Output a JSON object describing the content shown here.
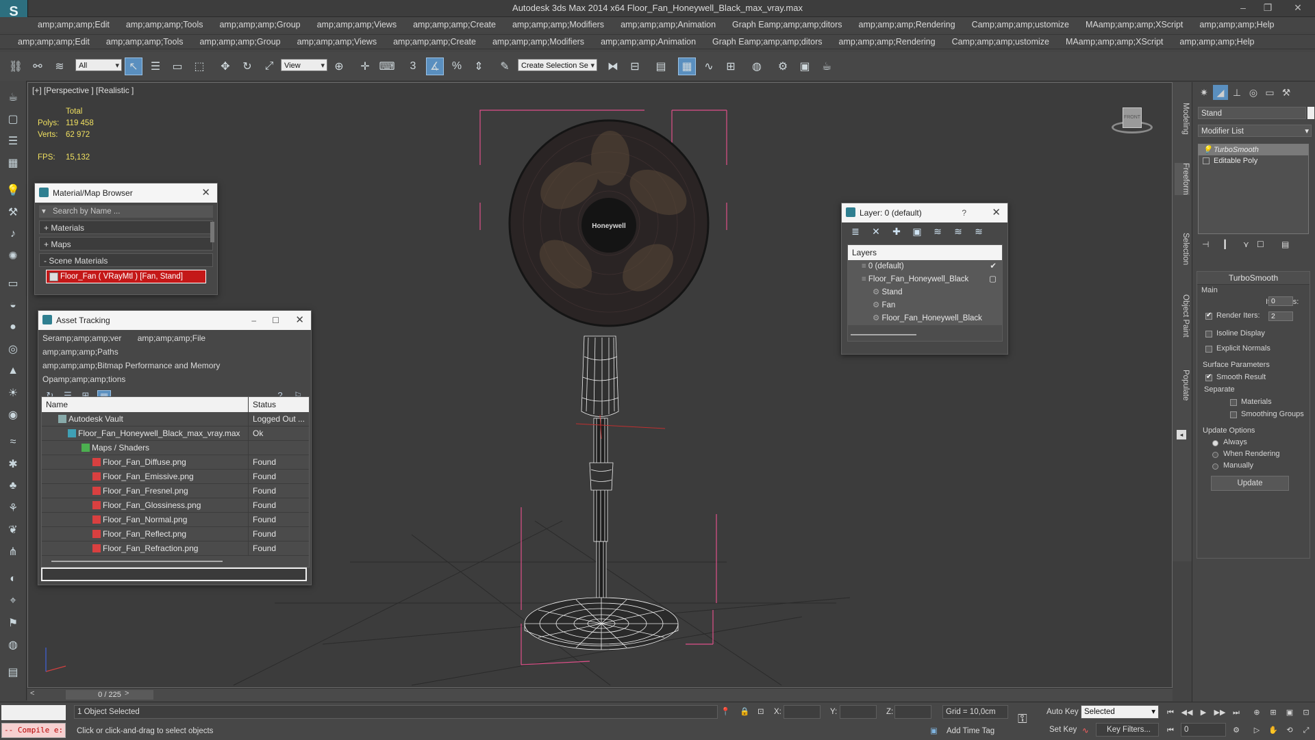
{
  "window": {
    "title": "Autodesk 3ds Max  2014 x64     Floor_Fan_Honeywell_Black_max_vray.max",
    "controls": [
      "–",
      "❐",
      "✕"
    ]
  },
  "menubar_top": [
    "amp;amp;amp;Edit",
    "amp;amp;amp;Tools",
    "amp;amp;amp;Group",
    "amp;amp;amp;Views",
    "amp;amp;amp;Create",
    "amp;amp;amp;Modifiers",
    "amp;amp;amp;Animation",
    "Graph Eamp;amp;amp;ditors",
    "amp;amp;amp;Rendering",
    "Camp;amp;amp;ustomize",
    "MAamp;amp;amp;XScript",
    "amp;amp;amp;Help"
  ],
  "menubar_bottom": [
    "amp;amp;amp;Edit",
    "amp;amp;amp;Tools",
    "amp;amp;amp;Group",
    "amp;amp;amp;Views",
    "amp;amp;amp;Create",
    "amp;amp;amp;Modifiers",
    "amp;amp;amp;Animation",
    "Graph Eamp;amp;amp;ditors",
    "amp;amp;amp;Rendering",
    "Camp;amp;amp;ustomize",
    "MAamp;amp;amp;XScript",
    "amp;amp;amp;Help"
  ],
  "toolbar": {
    "selection_filter": "All",
    "reference_coord": "View",
    "named_selection": "Create Selection Se"
  },
  "viewport": {
    "label": "[+] [Perspective ] [Realistic ]",
    "stats": {
      "total_label": "Total",
      "polys_label": "Polys:",
      "polys_value": "119 458",
      "verts_label": "Verts:",
      "verts_value": "62 972",
      "fps_label": "FPS:",
      "fps_value": "15,132"
    },
    "fan_brand": "Honeywell",
    "viewcube_label": "FRONT"
  },
  "material_browser": {
    "title": "Material/Map Browser",
    "search_placeholder": "Search by Name ...",
    "sections": [
      "+ Materials",
      "+ Maps",
      "- Scene Materials"
    ],
    "scene_item": "Floor_Fan  ( VRayMtl ) [Fan, Stand]"
  },
  "asset_tracking": {
    "title": "Asset Tracking",
    "menu_line1": [
      "Seramp;amp;amp;ver",
      "amp;amp;amp;File",
      "amp;amp;amp;Paths"
    ],
    "menu_line2": "amp;amp;amp;Bitmap Performance and Memory",
    "menu_line3": "Opamp;amp;amp;tions",
    "columns": {
      "name": "Name",
      "status": "Status"
    },
    "rows": [
      {
        "name": "Autodesk Vault",
        "status": "Logged Out ...",
        "indent": 0,
        "icon": "vault"
      },
      {
        "name": "Floor_Fan_Honeywell_Black_max_vray.max",
        "status": "Ok",
        "indent": 1,
        "icon": "max"
      },
      {
        "name": "Maps / Shaders",
        "status": "",
        "indent": 2,
        "icon": "maps"
      },
      {
        "name": "Floor_Fan_Diffuse.png",
        "status": "Found",
        "indent": 3,
        "icon": "png"
      },
      {
        "name": "Floor_Fan_Emissive.png",
        "status": "Found",
        "indent": 3,
        "icon": "png"
      },
      {
        "name": "Floor_Fan_Fresnel.png",
        "status": "Found",
        "indent": 3,
        "icon": "png"
      },
      {
        "name": "Floor_Fan_Glossiness.png",
        "status": "Found",
        "indent": 3,
        "icon": "png"
      },
      {
        "name": "Floor_Fan_Normal.png",
        "status": "Found",
        "indent": 3,
        "icon": "png"
      },
      {
        "name": "Floor_Fan_Reflect.png",
        "status": "Found",
        "indent": 3,
        "icon": "png"
      },
      {
        "name": "Floor_Fan_Refraction.png",
        "status": "Found",
        "indent": 3,
        "icon": "png"
      }
    ]
  },
  "layer_panel": {
    "title": "Layer: 0 (default)",
    "help": "?",
    "header": "Layers",
    "rows": [
      {
        "name": "0 (default)",
        "indent": 1,
        "check": "✔"
      },
      {
        "name": "Floor_Fan_Honeywell_Black",
        "indent": 1,
        "check": "▢"
      },
      {
        "name": "Stand",
        "indent": 2,
        "check": ""
      },
      {
        "name": "Fan",
        "indent": 2,
        "check": ""
      },
      {
        "name": "Floor_Fan_Honeywell_Black",
        "indent": 2,
        "check": ""
      }
    ]
  },
  "command_panel": {
    "object_name": "Stand",
    "modifier_list": "Modifier List",
    "stack": [
      "TurboSmooth",
      "Editable Poly"
    ],
    "turbosmooth": {
      "title": "TurboSmooth",
      "main_label": "Main",
      "iterations_label": "Iterations:",
      "iterations_value": "0",
      "render_iters_label": "Render Iters:",
      "render_iters_value": "2",
      "isoline_label": "Isoline Display",
      "explicit_normals_label": "Explicit Normals",
      "surface_params_label": "Surface Parameters",
      "smooth_result_label": "Smooth Result",
      "separate_label": "Separate",
      "materials_label": "Materials",
      "smoothing_groups_label": "Smoothing Groups",
      "update_options_label": "Update Options",
      "always_label": "Always",
      "when_rendering_label": "When Rendering",
      "manually_label": "Manually",
      "update_button": "Update"
    }
  },
  "vertical_tabs": [
    "Modeling",
    "Freeform",
    "Selection",
    "Object Paint",
    "Populate"
  ],
  "timeline": {
    "slider": "0 / 225",
    "prev": "<",
    "next": ">"
  },
  "status": {
    "selected_text": "1 Object Selected",
    "prompt_text": "Click or click-and-drag to select objects",
    "x_label": "X:",
    "y_label": "Y:",
    "z_label": "Z:",
    "grid_text": "Grid = 10,0cm",
    "add_time_tag": "Add Time Tag",
    "auto_key": "Auto Key",
    "set_key": "Set Key",
    "selected_dropdown": "Selected",
    "key_filters": "Key Filters...",
    "frame_value": "0",
    "compile_text": "-- Compile e:"
  },
  "colors": {
    "accent": "#5a8fbf",
    "stats": "#f0e060",
    "scene_material": "#c41818",
    "bounding_box": "#e0508a"
  }
}
